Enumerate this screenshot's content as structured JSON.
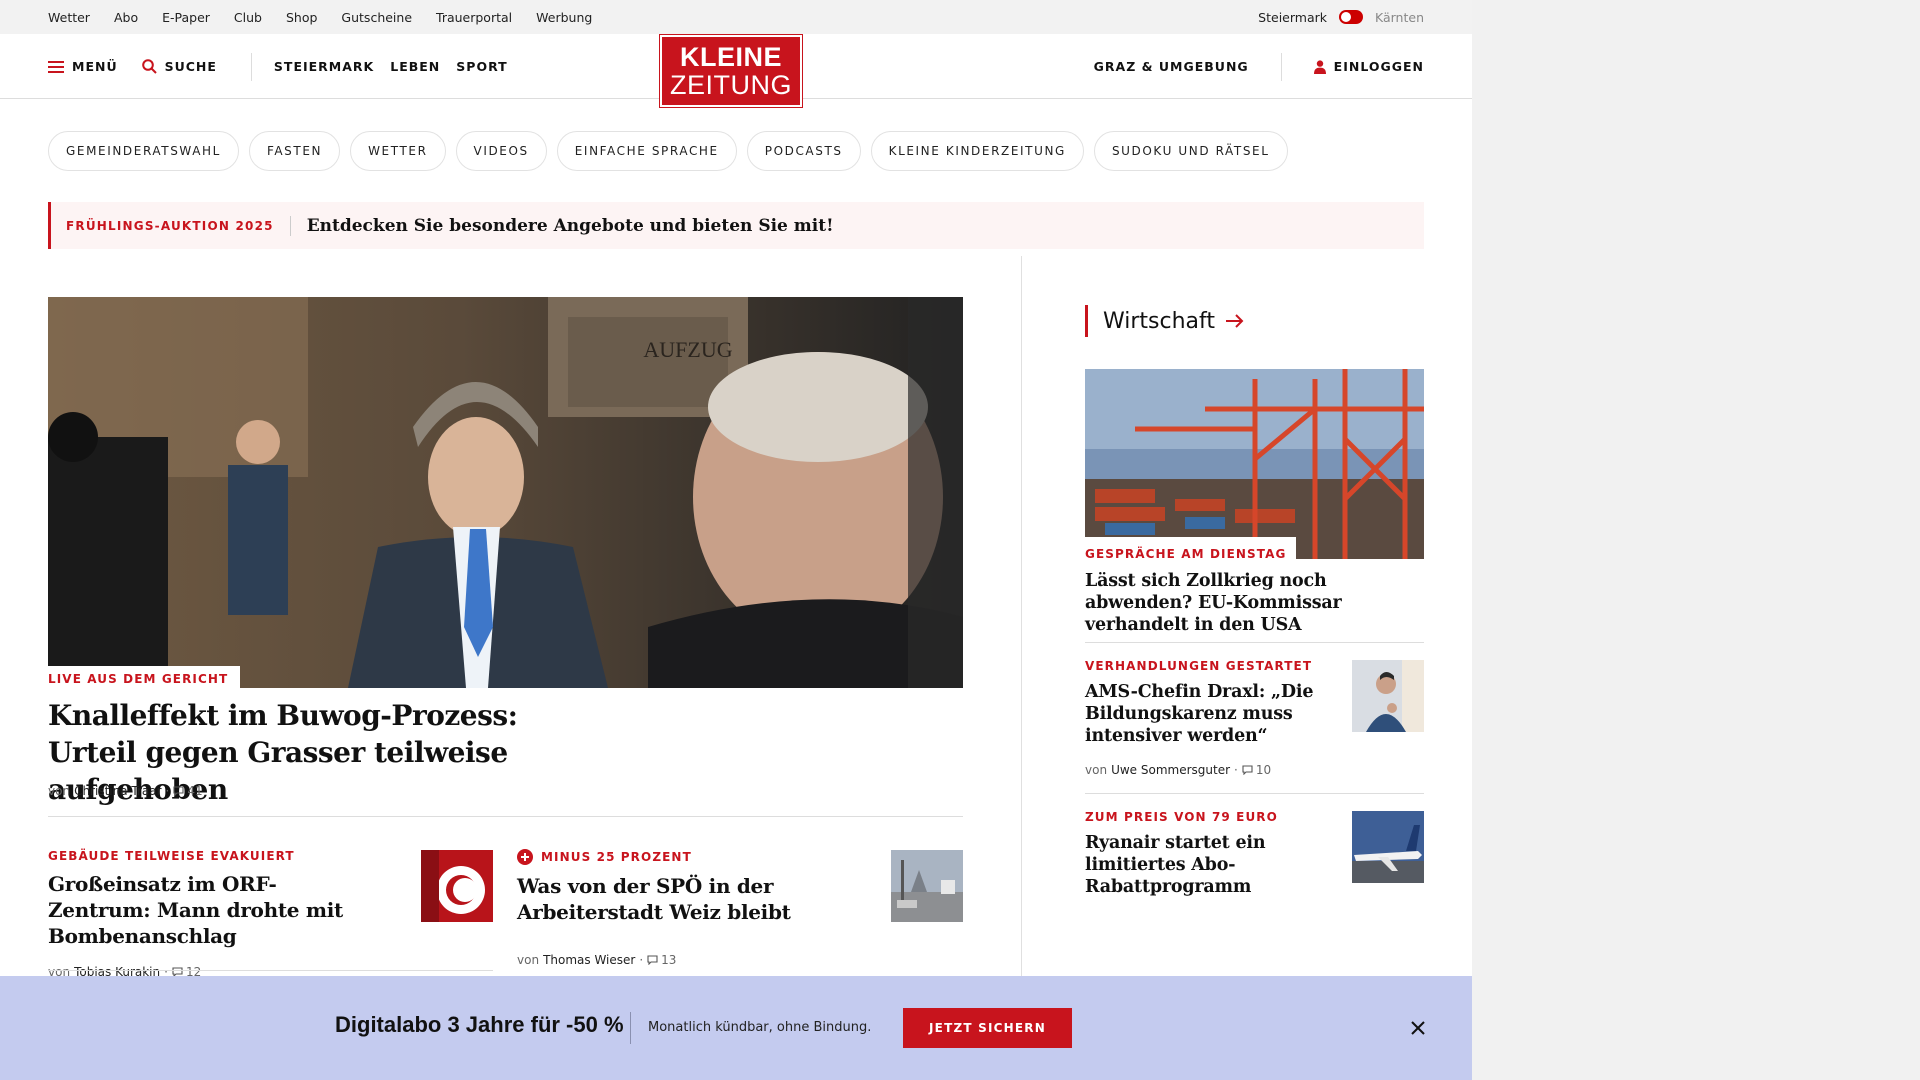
{
  "topbar": {
    "links": [
      "Wetter",
      "Abo",
      "E-Paper",
      "Club",
      "Shop",
      "Gutscheine",
      "Trauerportal",
      "Werbung"
    ],
    "region_active": "Steiermark",
    "region_inactive": "Kärnten"
  },
  "header": {
    "menu_label": "MENÜ",
    "search_label": "SUCHE",
    "nav": [
      "STEIERMARK",
      "LEBEN",
      "SPORT"
    ],
    "logo_line1": "KLEINE",
    "logo_line2": "ZEITUNG",
    "region_link": "GRAZ & UMGEBUNG",
    "login_label": "EINLOGGEN"
  },
  "pills": [
    "GEMEINDERATSWAHL",
    "FASTEN",
    "WETTER",
    "VIDEOS",
    "EINFACHE SPRACHE",
    "PODCASTS",
    "KLEINE KINDERZEITUNG",
    "SUDOKU UND RÄTSEL"
  ],
  "promo": {
    "tag": "FRÜHLINGS-AUKTION 2025",
    "text": "Entdecken Sie besondere Angebote und bieten Sie mit!"
  },
  "lead": {
    "image_text": "AUFZUG",
    "kicker": "LIVE AUS DEM GERICHT",
    "title": "Knalleffekt im Buwog-Prozess: Urteil gegen Grasser teilweise aufgehoben",
    "by": "von",
    "author": "Christina Traar",
    "comments": "41"
  },
  "sub_articles": [
    {
      "kicker": "GEBÄUDE TEILWEISE EVAKUIERT",
      "title": "Großeinsatz im ORF-Zentrum: Mann drohte mit Bombenanschlag",
      "by": "von",
      "author": "Tobias Kurakin",
      "comments": "12"
    },
    {
      "kicker": "MINUS 25 PROZENT",
      "title": "Was von der SPÖ in der Arbeiterstadt Weiz bleibt",
      "by": "von",
      "author": "Thomas Wieser",
      "comments": "13"
    }
  ],
  "sidebar": {
    "section_title": "Wirtschaft",
    "top": {
      "kicker": "GESPRÄCHE AM DIENSTAG",
      "title": "Lässt sich Zollkrieg noch abwenden? EU-Kommissar verhandelt in den USA"
    },
    "items": [
      {
        "kicker": "VERHANDLUNGEN GESTARTET",
        "title": "AMS-Chefin Draxl: „Die Bildungskarenz muss intensiver werden“",
        "by": "von",
        "author": "Uwe Sommersguter",
        "comments": "10"
      },
      {
        "kicker": "ZUM PREIS VON 79 EURO",
        "title": "Ryanair startet ein limitiertes Abo-Rabattprogramm"
      }
    ]
  },
  "banner": {
    "headline": "Digitalabo 3 Jahre für -50 %",
    "subtext": "Monatlich kündbar, ohne Bindung.",
    "cta": "JETZT SICHERN"
  },
  "colors": {
    "brand_red": "#c8141d",
    "banner_bg": "#c4cbef"
  }
}
